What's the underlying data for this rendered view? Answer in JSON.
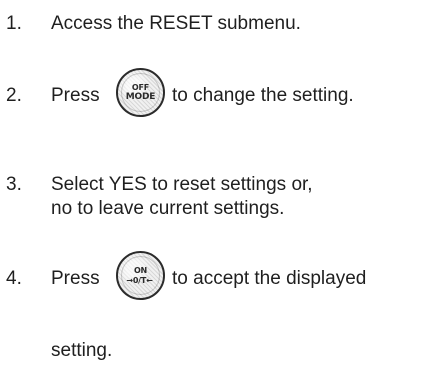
{
  "steps": [
    {
      "number": "1.",
      "text": "Access the RESET submenu."
    },
    {
      "number": "2.",
      "before_button": "Press",
      "after_button": "to change the setting.",
      "button": {
        "top_label": "OFF",
        "bottom_label": "MODE",
        "icon": "off-mode-button-icon"
      }
    },
    {
      "number": "3.",
      "line1": "Select YES to reset settings or,",
      "line2": "no to leave current settings."
    },
    {
      "number": "4.",
      "before_button": "Press",
      "after_button": "to accept the displayed",
      "line2": "setting.",
      "button": {
        "top_label": "ON",
        "bottom_label": "→0/T←",
        "icon": "on-zero-tare-button-icon"
      }
    }
  ]
}
